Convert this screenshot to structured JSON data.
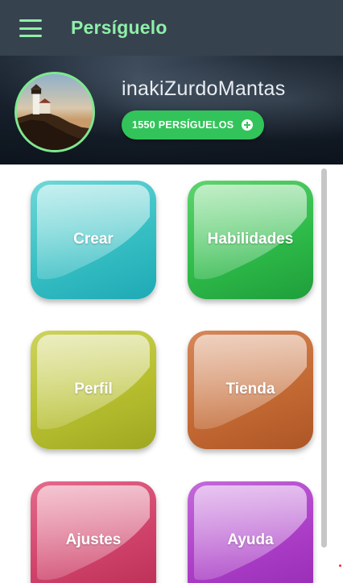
{
  "appbar": {
    "title": "Persíguelo",
    "menu_icon": "hamburger-menu-icon",
    "accent_color": "#8ef0a7",
    "background_color": "#37424f"
  },
  "profile": {
    "username": "inakiZurdoMantas",
    "points_label": "1550 PERSÍGUELOS",
    "points_icon": "plus-circle-icon",
    "avatar_description": "lighthouse-avatar",
    "points_button_color": "#32c45a"
  },
  "menu": {
    "tiles": [
      {
        "label": "Crear",
        "color": "#36bfc3"
      },
      {
        "label": "Habilidades",
        "color": "#2fbb4a"
      },
      {
        "label": "Perfil",
        "color": "#b7bf2f"
      },
      {
        "label": "Tienda",
        "color": "#c46a34"
      },
      {
        "label": "Ajustes",
        "color": "#d0426a"
      },
      {
        "label": "Ayuda",
        "color": "#ab3dc7"
      }
    ]
  }
}
